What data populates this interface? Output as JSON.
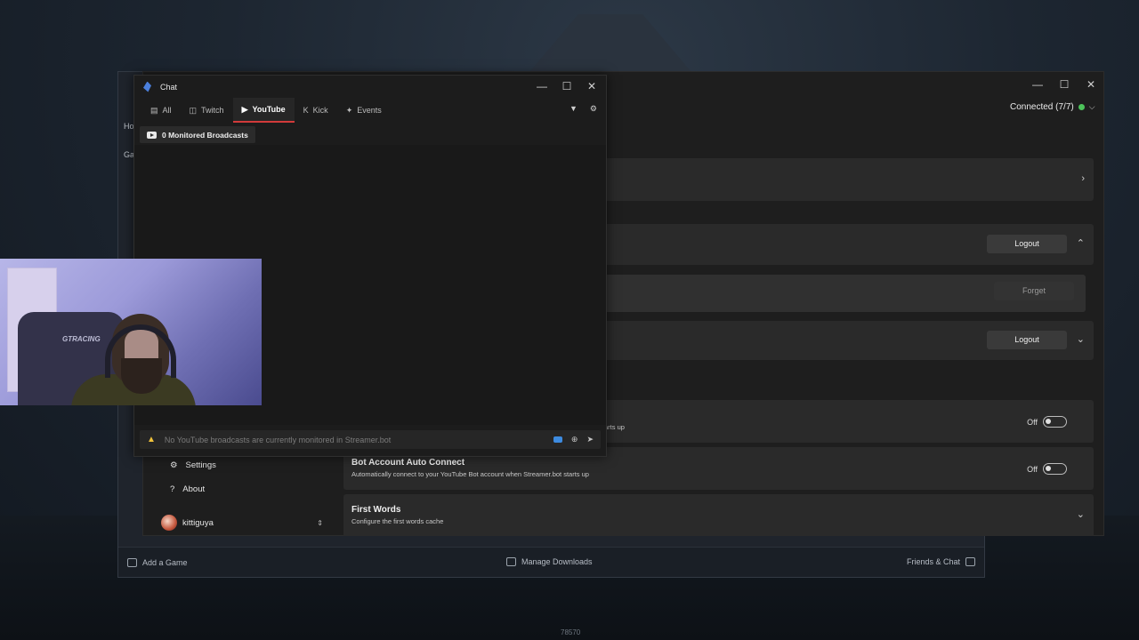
{
  "launcher": {
    "add_game": "Add a Game",
    "manage_downloads": "Manage Downloads",
    "friends_chat": "Friends & Chat",
    "left_fragments": [
      "Ho",
      "Ga"
    ]
  },
  "streamerbot": {
    "connection_status": "Connected (7/7)",
    "cards": {
      "broadcaster_logout": "Logout",
      "forget": "Forget",
      "bot_logout": "Logout",
      "auto_connect_partial": "arts up",
      "auto_connect_toggle": "Off",
      "bot_auto_connect_title": "Bot Account Auto Connect",
      "bot_auto_connect_desc": "Automatically connect to your YouTube Bot account when Streamer.bot starts up",
      "bot_auto_connect_toggle": "Off",
      "first_words_title": "First Words",
      "first_words_desc": "Configure the first words cache"
    },
    "sidebar": {
      "settings": "Settings",
      "about": "About",
      "user": "kittiguya"
    }
  },
  "chat": {
    "title": "Chat",
    "tabs": [
      {
        "label": "All",
        "icon": "chat-icon"
      },
      {
        "label": "Twitch",
        "icon": "twitch-icon"
      },
      {
        "label": "YouTube",
        "icon": "youtube-icon"
      },
      {
        "label": "Kick",
        "icon": "kick-icon"
      },
      {
        "label": "Events",
        "icon": "sparkle-icon"
      }
    ],
    "active_tab": "YouTube",
    "monitored": "0 Monitored Broadcasts",
    "input_placeholder": "No YouTube broadcasts are currently monitored in Streamer.bot"
  },
  "webcam": {
    "chair_brand": "GTRACING"
  },
  "desktop": {
    "bottom_number": "78570"
  },
  "colors": {
    "accent_red": "#d23a3a",
    "status_green": "#4cc35a",
    "warning_yellow": "#f0c23b"
  }
}
